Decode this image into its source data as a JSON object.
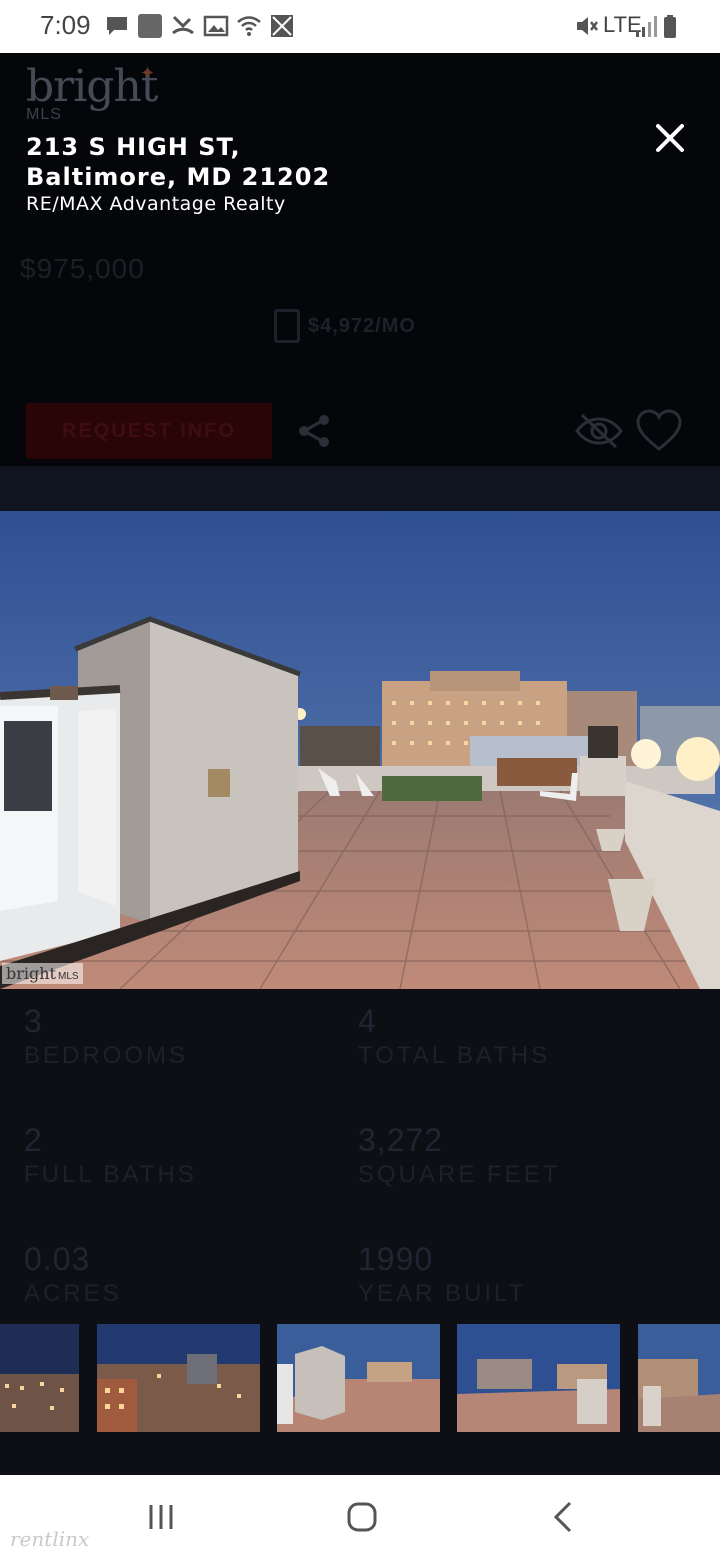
{
  "status_bar": {
    "time": "7:09",
    "network": "LTE",
    "icons": [
      "messages-icon",
      "app-icon",
      "missed-call-icon",
      "gallery-icon",
      "wifi-icon",
      "no-sim-icon",
      "mute-icon",
      "signal-icon",
      "battery-icon"
    ]
  },
  "brand": {
    "logo_word": "bright",
    "logo_sub": "MLS",
    "watermark_word": "bright",
    "watermark_sub": "MLS",
    "footer_watermark": "rentlinx"
  },
  "listing": {
    "address_line1": "213 S HIGH ST,",
    "address_line2": "Baltimore, MD 21202",
    "broker": "RE/MAX Advantage Realty",
    "price": "$975,000",
    "monthly": "$4,972/MO",
    "request_label": "REQUEST INFO"
  },
  "facts": [
    {
      "value": "3",
      "label": "BEDROOMS"
    },
    {
      "value": "4",
      "label": "TOTAL BATHS"
    },
    {
      "value": "2",
      "label": "FULL BATHS"
    },
    {
      "value": "3,272",
      "label": "SQUARE FEET"
    },
    {
      "value": "0.03",
      "label": "ACRES"
    },
    {
      "value": "1990",
      "label": "YEAR BUILT"
    }
  ],
  "colors": {
    "overlay_bg": "#050609",
    "request_btn": "#2a0508",
    "sky": "#3a5e9a",
    "tile": "#c08a78"
  }
}
